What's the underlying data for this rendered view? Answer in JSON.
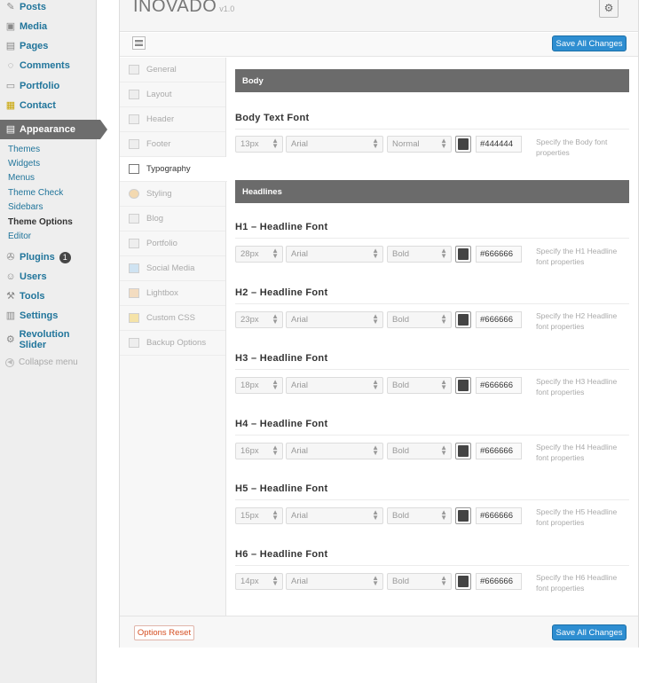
{
  "sidebar": {
    "menu": [
      {
        "label": "Posts",
        "icon": "pin-icon"
      },
      {
        "label": "Media",
        "icon": "media-icon"
      },
      {
        "label": "Pages",
        "icon": "pages-icon"
      },
      {
        "label": "Comments",
        "icon": "comment-icon"
      },
      {
        "label": "Portfolio",
        "icon": "folder-icon"
      },
      {
        "label": "Contact",
        "icon": "contact-icon"
      },
      {
        "label": "Appearance",
        "icon": "appearance-icon"
      }
    ],
    "submenu": [
      "Themes",
      "Widgets",
      "Menus",
      "Theme Check",
      "Sidebars",
      "Theme Options",
      "Editor"
    ],
    "menu2": [
      {
        "label": "Plugins",
        "icon": "plugin-icon",
        "badge": "1"
      },
      {
        "label": "Users",
        "icon": "users-icon"
      },
      {
        "label": "Tools",
        "icon": "tools-icon"
      },
      {
        "label": "Settings",
        "icon": "settings-icon"
      },
      {
        "label": "Revolution Slider",
        "icon": "gear-icon"
      }
    ],
    "collapse_label": "Collapse menu"
  },
  "header": {
    "brand": "INOVADO",
    "version": "v1.0"
  },
  "toolbar": {
    "save_label": "Save All Changes"
  },
  "nav": [
    "General",
    "Layout",
    "Header",
    "Footer",
    "Typography",
    "Styling",
    "Blog",
    "Portfolio",
    "Social Media",
    "Lightbox",
    "Custom CSS",
    "Backup Options"
  ],
  "body_section": {
    "title": "Body",
    "font_title": "Body Text Font",
    "size": "13px",
    "family": "Arial",
    "weight": "Normal",
    "color": "#444444",
    "hint": "Specify the Body font properties"
  },
  "headlines_section": {
    "title": "Headlines",
    "rows": [
      {
        "title": "H1 – Headline Font",
        "size": "28px",
        "family": "Arial",
        "weight": "Bold",
        "color": "#666666",
        "hint": "Specify the H1 Headline font properties"
      },
      {
        "title": "H2 – Headline Font",
        "size": "23px",
        "family": "Arial",
        "weight": "Bold",
        "color": "#666666",
        "hint": "Specify the H2 Headline font properties"
      },
      {
        "title": "H3 – Headline Font",
        "size": "18px",
        "family": "Arial",
        "weight": "Bold",
        "color": "#666666",
        "hint": "Specify the H3 Headline font properties"
      },
      {
        "title": "H4 – Headline Font",
        "size": "16px",
        "family": "Arial",
        "weight": "Bold",
        "color": "#666666",
        "hint": "Specify the H4 Headline font properties"
      },
      {
        "title": "H5 – Headline Font",
        "size": "15px",
        "family": "Arial",
        "weight": "Bold",
        "color": "#666666",
        "hint": "Specify the H5 Headline font properties"
      },
      {
        "title": "H6 – Headline Font",
        "size": "14px",
        "family": "Arial",
        "weight": "Bold",
        "color": "#666666",
        "hint": "Specify the H6 Headline font properties"
      }
    ]
  },
  "footer": {
    "reset_label": "Options Reset",
    "save_label": "Save All Changes"
  },
  "colors": {
    "accent": "#2e8ed1",
    "wp_link": "#21759b",
    "section_bar": "#6b6b6b"
  }
}
